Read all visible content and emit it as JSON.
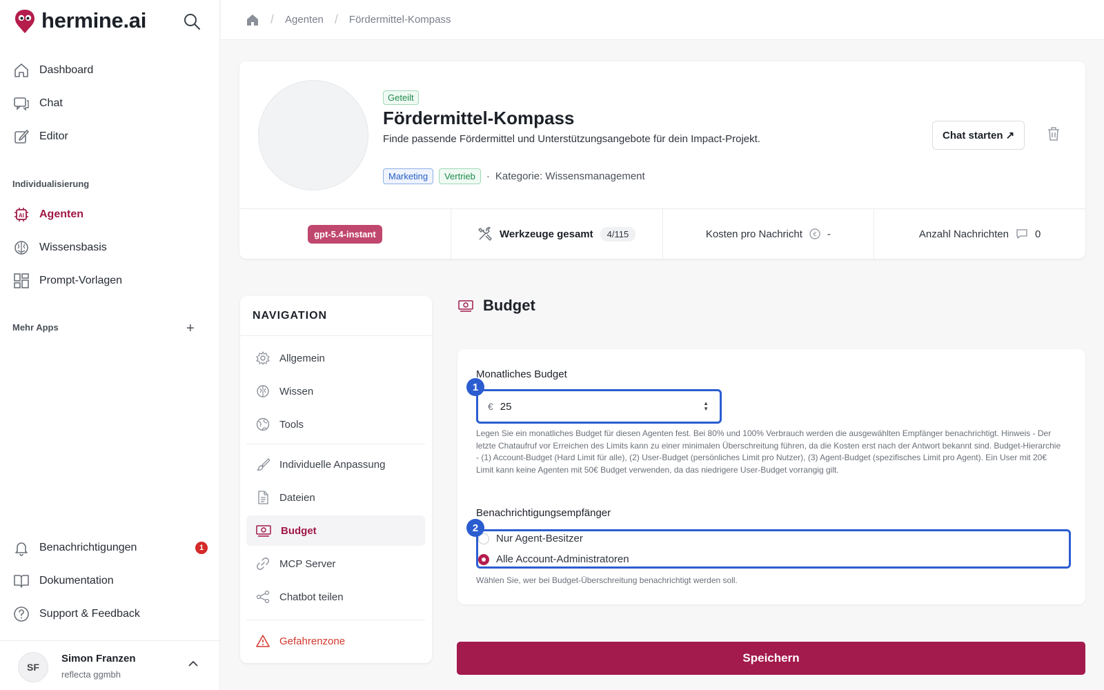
{
  "app": {
    "logo_text": "hermine.ai"
  },
  "sidebar": {
    "items": [
      {
        "label": "Dashboard",
        "icon": "home-icon"
      },
      {
        "label": "Chat",
        "icon": "chat-icon"
      },
      {
        "label": "Editor",
        "icon": "edit-icon"
      }
    ],
    "section_individual": "Individualisierung",
    "individual_items": [
      {
        "label": "Agenten",
        "icon": "agent-icon",
        "active": true
      },
      {
        "label": "Wissensbasis",
        "icon": "brain-icon"
      },
      {
        "label": "Prompt-Vorlagen",
        "icon": "template-icon"
      }
    ],
    "section_more": "Mehr Apps",
    "more_add": "+",
    "bottom_items": [
      {
        "label": "Benachrichtigungen",
        "icon": "bell-icon",
        "badge": "1"
      },
      {
        "label": "Dokumentation",
        "icon": "book-icon"
      },
      {
        "label": "Support & Feedback",
        "icon": "help-icon"
      }
    ],
    "user": {
      "initials": "SF",
      "name": "Simon Franzen",
      "org": "reflecta ggmbh"
    }
  },
  "breadcrumb": {
    "items": [
      "Agenten",
      "Fördermittel-Kompass"
    ]
  },
  "agent": {
    "shared_tag": "Geteilt",
    "title": "Fördermittel-Kompass",
    "description": "Finde passende Fördermittel und Unterstützungsangebote für dein Impact-Projekt.",
    "tags": [
      "Marketing",
      "Vertrieb"
    ],
    "dot": "·",
    "category": "Kategorie: Wissensmanagement",
    "chat_button": "Chat starten ↗",
    "stats": {
      "model": "gpt-5.4-instant",
      "tools_label": "Werkzeuge gesamt",
      "tools_count": "4/115",
      "cost_label": "Kosten pro Nachricht",
      "cost_value": "-",
      "messages_label": "Anzahl Nachrichten",
      "messages_value": "0"
    }
  },
  "navigation": {
    "title": "NAVIGATION",
    "items": [
      {
        "label": "Allgemein",
        "icon": "gear-icon"
      },
      {
        "label": "Wissen",
        "icon": "brain-icon"
      },
      {
        "label": "Tools",
        "icon": "globe-icon"
      },
      {
        "label": "Individuelle Anpassung",
        "icon": "brush-icon"
      },
      {
        "label": "Dateien",
        "icon": "file-icon"
      },
      {
        "label": "Budget",
        "icon": "money-icon",
        "active": true
      },
      {
        "label": "MCP Server",
        "icon": "link-icon"
      },
      {
        "label": "Chatbot teilen",
        "icon": "share-icon"
      },
      {
        "label": "Gefahrenzone",
        "icon": "warning-icon"
      }
    ]
  },
  "budget": {
    "title": "Budget",
    "monthly_label": "Monatliches Budget",
    "currency": "€",
    "value": "25",
    "help": "Legen Sie ein monatliches Budget für diesen Agenten fest. Bei 80% und 100% Verbrauch werden die ausgewählten Empfänger benachrichtigt. Hinweis - Der letzte Chataufruf vor Erreichen des Limits kann zu einer minimalen Überschreitung führen, da die Kosten erst nach der Antwort bekannt sind. Budget-Hierarchie - (1) Account-Budget (Hard Limit für alle), (2) User-Budget (persönliches Limit pro Nutzer), (3) Agent-Budget (spezifisches Limit pro Agent). Ein User mit 20€ Limit kann keine Agenten mit 50€ Budget verwenden, da das niedrigere User-Budget vorrangig gilt.",
    "recipients_label": "Benachrichtigungsempfänger",
    "options": [
      {
        "label": "Nur Agent-Besitzer",
        "checked": false
      },
      {
        "label": "Alle Account-Administratoren",
        "checked": true
      }
    ],
    "recipients_help": "Wählen Sie, wer bei Budget-Überschreitung benachrichtigt werden soll.",
    "markers": [
      "1",
      "2"
    ],
    "save": "Speichern"
  },
  "colors": {
    "accent": "#a31a4c",
    "highlight": "#2b5dd1"
  }
}
